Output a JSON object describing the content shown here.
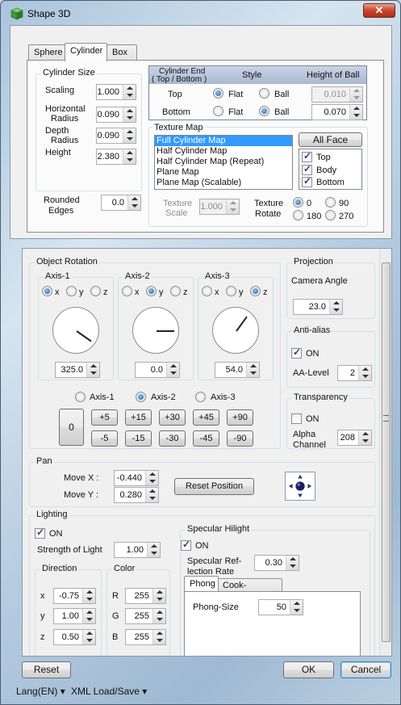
{
  "window": {
    "title": "Shape 3D",
    "close": "✕"
  },
  "tabs": [
    "Sphere",
    "Cylinder",
    "Box"
  ],
  "cylinder_size": {
    "title": "Cylinder Size",
    "scaling_label": "Scaling",
    "scaling": "1.000",
    "hradius_label1": "Horizontal",
    "hradius_label2": "Radius",
    "hradius": "0.090",
    "dradius_label1": "Depth",
    "dradius_label2": "Radius",
    "dradius": "0.090",
    "height_label": "Height",
    "height": "2.380"
  },
  "rounded": {
    "label1": "Rounded",
    "label2": "Edges",
    "value": "0.0"
  },
  "cylinder_end": {
    "title1": "Cylinder End",
    "title2": "( Top / Bottom )",
    "style_header": "Style",
    "hob_header": "Height of Ball",
    "top_label": "Top",
    "bottom_label": "Bottom",
    "flat": "Flat",
    "ball": "Ball",
    "top_style": "Flat",
    "bottom_style": "Ball",
    "top_height": "0.010",
    "bottom_height": "0.070"
  },
  "texture_map": {
    "title": "Texture Map",
    "items": [
      "Full Cylinder Map",
      "Half Cylinder Map",
      "Half Cylinder Map (Repeat)",
      "Plane Map",
      "Plane Map (Scalable)"
    ],
    "selected": 0,
    "all_face": "All Face",
    "faces": [
      {
        "label": "Top",
        "checked": true
      },
      {
        "label": "Body",
        "checked": true
      },
      {
        "label": "Bottom",
        "checked": true
      }
    ],
    "scale_label1": "Texture",
    "scale_label2": "Scale",
    "scale": "1.000",
    "rotate_label1": "Texture",
    "rotate_label2": "Rotate",
    "rotate_options": [
      "0",
      "90",
      "180",
      "270"
    ],
    "rotate_selected": "0"
  },
  "object_rotation": {
    "title": "Object Rotation",
    "axes": [
      {
        "title": "Axis-1",
        "selected": "x",
        "value": "325.0",
        "angle": 325
      },
      {
        "title": "Axis-2",
        "selected": "y",
        "value": "0.0",
        "angle": 0
      },
      {
        "title": "Axis-3",
        "selected": "z",
        "value": "54.0",
        "angle": 54
      }
    ],
    "xyz": [
      "x",
      "y",
      "z"
    ],
    "axis_choices": [
      "Axis-1",
      "Axis-2",
      "Axis-3"
    ],
    "axis_selected": "Axis-2",
    "zero": "0",
    "plus": [
      "+5",
      "+15",
      "+30",
      "+45",
      "+90"
    ],
    "minus": [
      "-5",
      "-15",
      "-30",
      "-45",
      "-90"
    ]
  },
  "projection": {
    "title": "Projection",
    "camera_label": "Camera Angle",
    "camera": "23.0"
  },
  "antialias": {
    "title": "Anti-alias",
    "on_label": "ON",
    "on": true,
    "level_label": "AA-Level",
    "level": "2"
  },
  "transparency": {
    "title": "Transparency",
    "on_label": "ON",
    "on": false,
    "alpha_label1": "Alpha",
    "alpha_label2": "Channel",
    "alpha": "208"
  },
  "pan": {
    "title": "Pan",
    "movex_label": "Move X :",
    "movex": "-0.440",
    "movey_label": "Move Y :",
    "movey": "0.280",
    "reset": "Reset Position"
  },
  "lighting": {
    "title": "Lighting",
    "on_label": "ON",
    "on": true,
    "strength_label": "Strength of Light",
    "strength": "1.00",
    "direction_title": "Direction",
    "dir": [
      {
        "k": "x",
        "v": "-0.75"
      },
      {
        "k": "y",
        "v": "1.00"
      },
      {
        "k": "z",
        "v": "0.50"
      }
    ],
    "color_title": "Color",
    "col": [
      {
        "k": "R",
        "v": "255"
      },
      {
        "k": "G",
        "v": "255"
      },
      {
        "k": "B",
        "v": "255"
      }
    ]
  },
  "specular": {
    "title": "Specular Hilight",
    "on_label": "ON",
    "on": true,
    "rate_label1": "Specular Ref-",
    "rate_label2": "lection Rate",
    "rate": "0.30",
    "tabs": [
      "Phong",
      "Cook-Torrance"
    ],
    "phong_label": "Phong-Size",
    "phong": "50"
  },
  "footer": {
    "reset": "Reset",
    "ok": "OK",
    "cancel": "Cancel",
    "lang": "Lang(EN) ▾",
    "xml": "XML Load/Save ▾"
  },
  "colors": {
    "accent": "#3399ff",
    "title_close": "#c8442c"
  }
}
